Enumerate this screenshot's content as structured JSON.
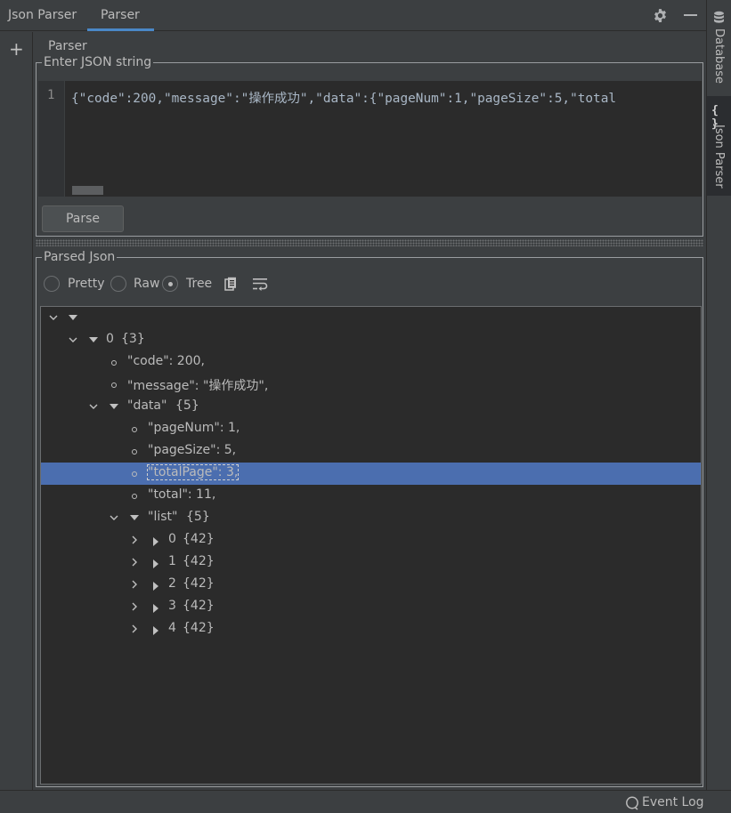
{
  "toolwindow": {
    "title": "Json Parser",
    "tab": "Parser",
    "subtab": "Parser"
  },
  "right_stripe": {
    "items": [
      {
        "label": "Database",
        "icon": "database-icon"
      },
      {
        "label": "Json Parser",
        "icon": "braces-icon",
        "active": true
      }
    ]
  },
  "input_section": {
    "title": "Enter JSON string",
    "line_number": "1",
    "json_text": "{\"code\":200,\"message\":\"操作成功\",\"data\":{\"pageNum\":1,\"pageSize\":5,\"total",
    "parse_button": "Parse"
  },
  "output_section": {
    "title": "Parsed Json",
    "view_modes": [
      {
        "label": "Pretty",
        "checked": false
      },
      {
        "label": "Raw",
        "checked": false
      },
      {
        "label": "Tree",
        "checked": true
      }
    ],
    "tree": [
      {
        "label": "",
        "level": 0,
        "type": "expanded"
      },
      {
        "label": "0",
        "count": "{3}",
        "level": 1,
        "type": "expanded"
      },
      {
        "label": "\"code\": 200,",
        "level": 2,
        "type": "leaf"
      },
      {
        "label": "\"message\": \"操作成功\",",
        "level": 2,
        "type": "leaf"
      },
      {
        "label": "\"data\"",
        "count": "{5}",
        "level": 2,
        "type": "expanded"
      },
      {
        "label": "\"pageNum\": 1,",
        "level": 3,
        "type": "leaf"
      },
      {
        "label": "\"pageSize\": 5,",
        "level": 3,
        "type": "leaf"
      },
      {
        "label": "\"totalPage\": 3,",
        "level": 3,
        "type": "leaf",
        "selected": true
      },
      {
        "label": "\"total\": 11,",
        "level": 3,
        "type": "leaf"
      },
      {
        "label": "\"list\"",
        "count": "{5}",
        "level": 3,
        "type": "expanded"
      },
      {
        "label": "0",
        "count": "{42}",
        "level": 4,
        "type": "collapsed"
      },
      {
        "label": "1",
        "count": "{42}",
        "level": 4,
        "type": "collapsed"
      },
      {
        "label": "2",
        "count": "{42}",
        "level": 4,
        "type": "collapsed"
      },
      {
        "label": "3",
        "count": "{42}",
        "level": 4,
        "type": "collapsed"
      },
      {
        "label": "4",
        "count": "{42}",
        "level": 4,
        "type": "collapsed"
      }
    ]
  },
  "statusbar": {
    "event_log": "Event Log"
  },
  "colors": {
    "background": "#3c3f41",
    "editor_background": "#2b2b2b",
    "selection": "#4b6eaf",
    "accent": "#4a88c7"
  }
}
